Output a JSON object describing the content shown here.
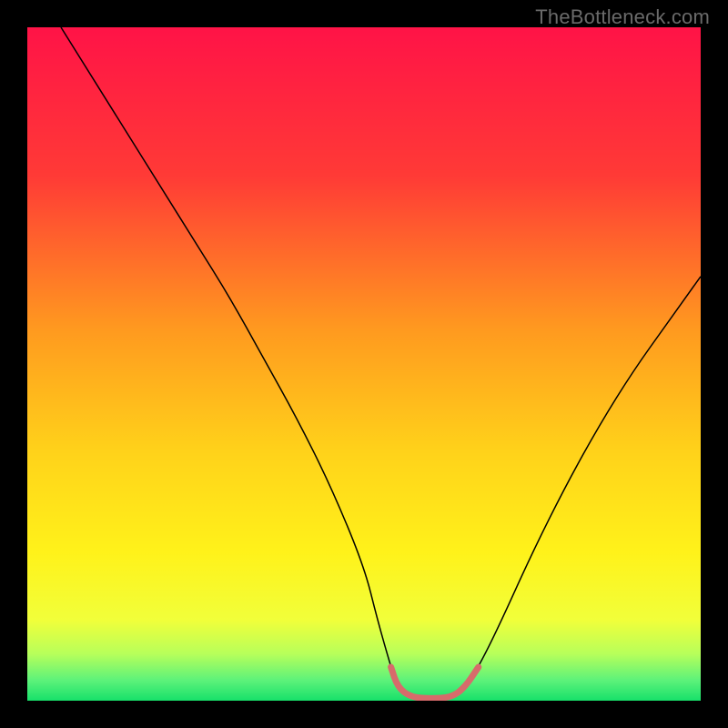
{
  "watermark": "TheBottleneck.com",
  "chart_data": {
    "type": "line",
    "title": "",
    "xlabel": "",
    "ylabel": "",
    "xlim": [
      0,
      100
    ],
    "ylim": [
      0,
      100
    ],
    "legend": false,
    "axes_visible": false,
    "background": {
      "type": "vertical_gradient",
      "stops": [
        {
          "pos": 0.0,
          "color": "#ff1347"
        },
        {
          "pos": 0.22,
          "color": "#ff3a36"
        },
        {
          "pos": 0.45,
          "color": "#ff9a1f"
        },
        {
          "pos": 0.63,
          "color": "#ffd21a"
        },
        {
          "pos": 0.78,
          "color": "#fff21a"
        },
        {
          "pos": 0.88,
          "color": "#f1ff3a"
        },
        {
          "pos": 0.93,
          "color": "#b8ff5a"
        },
        {
          "pos": 0.97,
          "color": "#5cf27a"
        },
        {
          "pos": 1.0,
          "color": "#17e06a"
        }
      ]
    },
    "series": [
      {
        "name": "bottleneck-curve",
        "color": "#000000",
        "width": 1.5,
        "x": [
          5,
          10,
          15,
          20,
          25,
          30,
          35,
          40,
          45,
          50,
          52,
          54,
          55,
          57,
          60,
          63,
          65,
          67,
          70,
          75,
          80,
          85,
          90,
          95,
          100
        ],
        "y": [
          100,
          92,
          84,
          76,
          68,
          60,
          51,
          42,
          32,
          20,
          12,
          5,
          2,
          0.5,
          0.3,
          0.5,
          2,
          5,
          11,
          22,
          32,
          41,
          49,
          56,
          63
        ]
      },
      {
        "name": "optimal-zone",
        "color": "#d76b6b",
        "width": 7,
        "cap": "round",
        "x": [
          54,
          55,
          57,
          60,
          63,
          65,
          67
        ],
        "y": [
          5,
          2,
          0.5,
          0.3,
          0.5,
          2,
          5
        ]
      }
    ]
  }
}
